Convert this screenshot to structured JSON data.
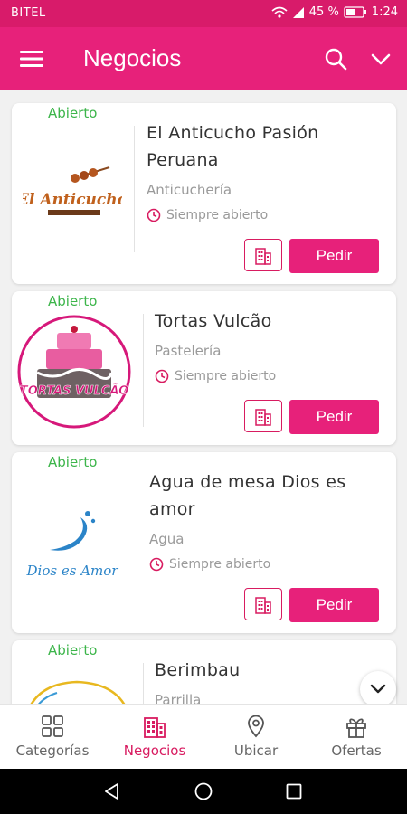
{
  "status_bar": {
    "carrier": "BITEL",
    "battery": "45 %",
    "time": "1:24",
    "icons": [
      "wifi-icon",
      "signal-icon",
      "battery-icon"
    ]
  },
  "app_bar": {
    "title": "Negocios",
    "icons": [
      "menu-icon",
      "search-icon",
      "chevron-down-icon"
    ]
  },
  "businesses": [
    {
      "status": "Abierto",
      "name_line1": "El Anticucho Pasión",
      "name_line2": "Peruana",
      "category": "Anticuchería",
      "hours": "Siempre abierto",
      "logo_text": "El Anticucho",
      "action": "Pedir"
    },
    {
      "status": "Abierto",
      "name_line1": "Tortas Vulcão",
      "name_line2": "",
      "category": "Pastelería",
      "hours": "Siempre abierto",
      "logo_text": "TORTAS VULCÃO",
      "action": "Pedir"
    },
    {
      "status": "Abierto",
      "name_line1": "Agua de mesa Dios es",
      "name_line2": "amor",
      "category": "Agua",
      "hours": "Siempre abierto",
      "logo_text": "Dios es Amor",
      "action": "Pedir"
    },
    {
      "status": "Abierto",
      "name_line1": "Berimbau",
      "name_line2": "",
      "category": "Parrilla",
      "hours": "",
      "logo_text": "",
      "action": ""
    }
  ],
  "bottom_nav": [
    {
      "label": "Categorías",
      "icon": "grid-icon",
      "active": false
    },
    {
      "label": "Negocios",
      "icon": "building-icon",
      "active": true
    },
    {
      "label": "Ubicar",
      "icon": "location-pin-icon",
      "active": false
    },
    {
      "label": "Ofertas",
      "icon": "gift-icon",
      "active": false
    }
  ],
  "colors": {
    "primary": "#e7217a",
    "status_bar": "#d81b6a",
    "open_status": "#3cb54a",
    "active_nav": "#d81b60"
  },
  "system_nav": [
    "back-icon",
    "home-icon",
    "recents-icon"
  ]
}
